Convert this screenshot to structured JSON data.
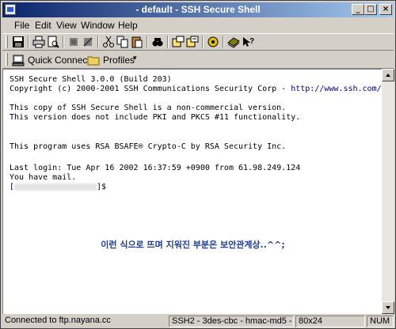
{
  "window": {
    "title": "- default - SSH Secure Shell"
  },
  "menu": [
    "File",
    "Edit",
    "View",
    "Window",
    "Help"
  ],
  "toolbar2": {
    "quick_connect": "Quick Connect",
    "profiles": "Profiles"
  },
  "terminal": {
    "lines": [
      "SSH Secure Shell 3.0.0 (Build 203)",
      "Copyright (c) 2000-2001 SSH Communications Security Corp - ",
      "This copy of SSH Secure Shell is a non-commercial version.",
      "This version does not include PKI and PKCS #11 functionality.",
      "This program uses RSA BSAFE® Crypto-C by RSA Security Inc.",
      "Last login: Tue Apr 16 2002 16:37:59 +0900 from 61.98.249.124",
      "You have mail."
    ],
    "url": "http://www.ssh.com/",
    "prompt_open": "[",
    "prompt_close": "]$",
    "caption": "이런 식으로 뜨며 지워진 부분은 보안관계상..^^;"
  },
  "status": {
    "connection": "Connected to ftp.nayana.cc",
    "cipher": "SSH2 - 3des-cbc - hmac-md5 -",
    "size": "80x24",
    "num": "NUM"
  },
  "colors": {
    "titlebar_start": "#0a246a",
    "titlebar_end": "#a6caf0",
    "caption": "#1c3c98"
  }
}
